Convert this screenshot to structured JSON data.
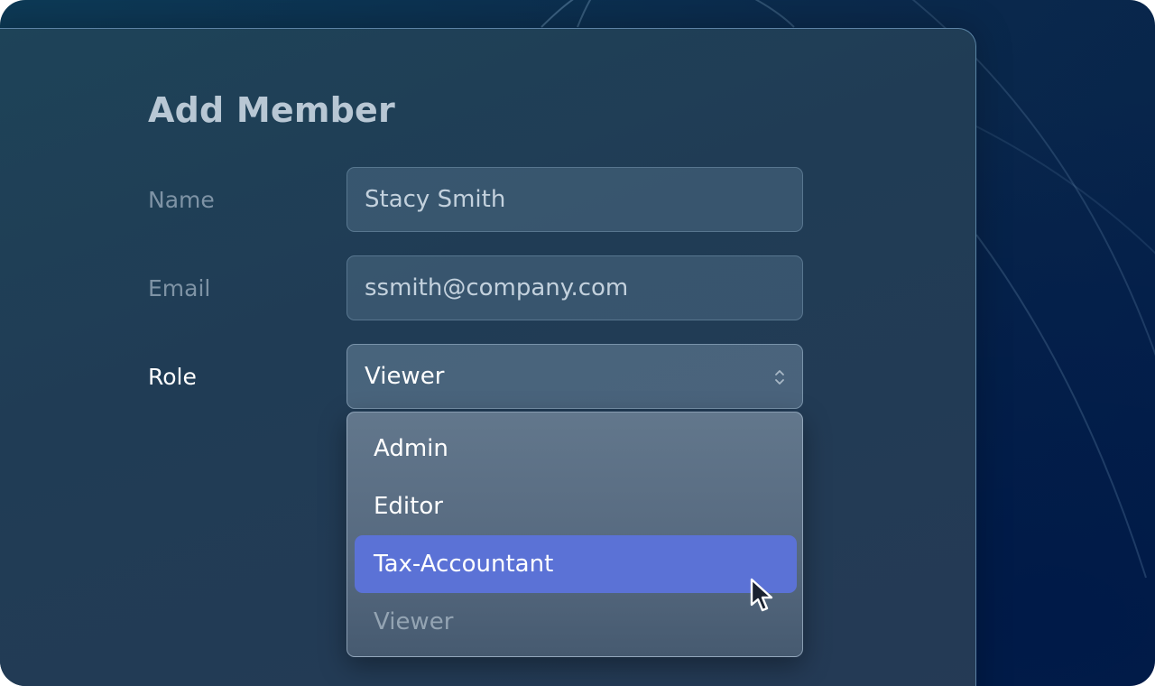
{
  "dialog": {
    "title": "Add Member"
  },
  "form": {
    "name": {
      "label": "Name",
      "value": "Stacy Smith"
    },
    "email": {
      "label": "Email",
      "value": "ssmith@company.com"
    },
    "role": {
      "label": "Role",
      "value": "Viewer"
    }
  },
  "role_dropdown": {
    "options": [
      {
        "label": "Admin",
        "state": "normal"
      },
      {
        "label": "Editor",
        "state": "normal"
      },
      {
        "label": "Tax-Accountant",
        "state": "hovered"
      },
      {
        "label": "Viewer",
        "state": "selected"
      }
    ]
  },
  "colors": {
    "highlight": "#5b72d6",
    "card_border": "#8cbee6"
  },
  "icons": {
    "select_indicator": "chevron-up-down-icon",
    "pointer": "mouse-cursor-icon"
  }
}
